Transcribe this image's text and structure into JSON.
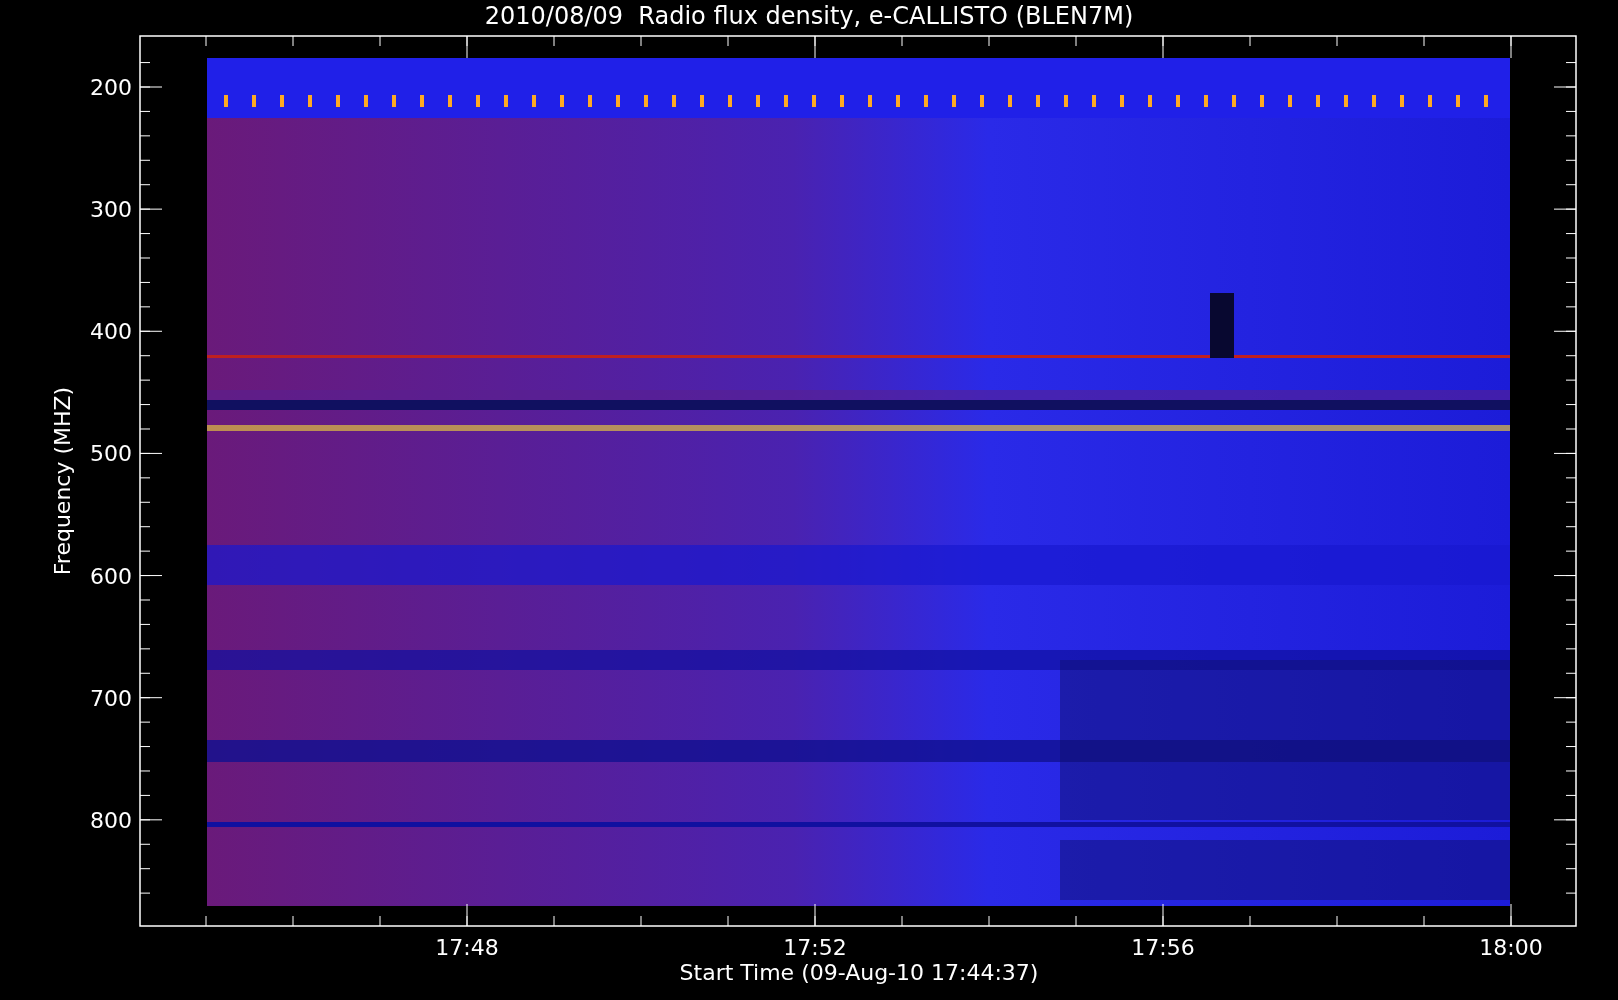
{
  "title": "2010/08/09  Radio flux density, e-CALLISTO (BLEN7M)",
  "plot": {
    "ylabel": "Frequency (MHZ)",
    "xlabel": "Start Time (09-Aug-10 17:44:37)",
    "yticks": [
      "200",
      "300",
      "400",
      "500",
      "600",
      "700",
      "800"
    ],
    "xticks": [
      "17:48",
      "17:52",
      "17:56",
      "18:00"
    ]
  }
}
